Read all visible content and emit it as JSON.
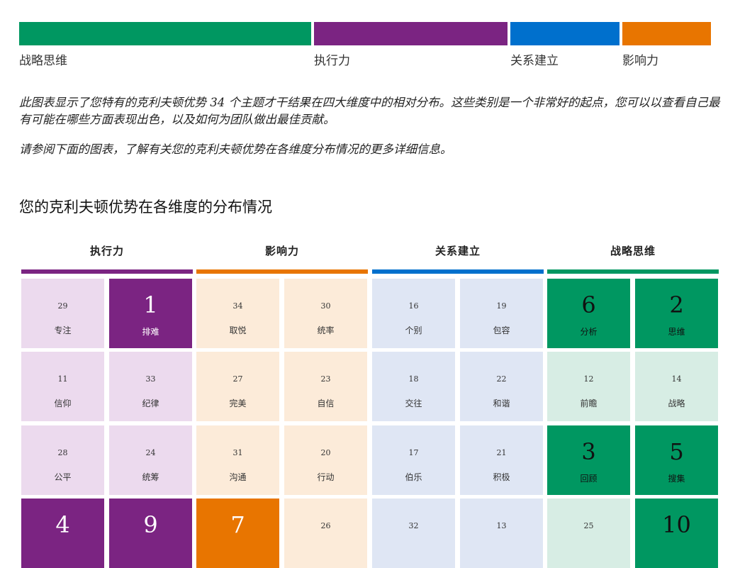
{
  "colors": {
    "execution": "#7b2482",
    "execution_light": "#ecdaee",
    "influence": "#e87500",
    "influence_light": "#fcebd9",
    "relationship": "#0070cd",
    "relationship_light": "#dfe6f4",
    "strategic": "#009761",
    "strategic_light": "#d7ede4"
  },
  "top_bars": [
    {
      "label": "战略思维",
      "key": "strategic"
    },
    {
      "label": "执行力",
      "key": "execution"
    },
    {
      "label": "关系建立",
      "key": "relationship"
    },
    {
      "label": "影响力",
      "key": "influence"
    }
  ],
  "intro": {
    "paragraph1": "此图表显示了您特有的克利夫顿优势 34 个主题才干结果在四大维度中的相对分布。这些类别是一个非常好的起点，您可以以查看自己最有可能在哪些方面表现出色，以及如何为团队做出最佳贡献。",
    "paragraph2": "请参阅下面的图表，了解有关您的克利夫顿优势在各维度分布情况的更多详细信息。"
  },
  "section_title": "您的克利夫顿优势在各维度的分布情况",
  "domains": [
    {
      "name": "执行力",
      "key": "execution",
      "themes": [
        {
          "rank": "29",
          "name": "专注",
          "strong": false
        },
        {
          "rank": "1",
          "name": "排难",
          "strong": true
        },
        {
          "rank": "11",
          "name": "信仰",
          "strong": false
        },
        {
          "rank": "33",
          "name": "纪律",
          "strong": false
        },
        {
          "rank": "28",
          "name": "公平",
          "strong": false
        },
        {
          "rank": "24",
          "name": "统筹",
          "strong": false
        },
        {
          "rank": "4",
          "name": "",
          "strong": true
        },
        {
          "rank": "9",
          "name": "",
          "strong": true
        }
      ]
    },
    {
      "name": "影响力",
      "key": "influence",
      "themes": [
        {
          "rank": "34",
          "name": "取悦",
          "strong": false
        },
        {
          "rank": "30",
          "name": "统率",
          "strong": false
        },
        {
          "rank": "27",
          "name": "完美",
          "strong": false
        },
        {
          "rank": "23",
          "name": "自信",
          "strong": false
        },
        {
          "rank": "31",
          "name": "沟通",
          "strong": false
        },
        {
          "rank": "20",
          "name": "行动",
          "strong": false
        },
        {
          "rank": "7",
          "name": "",
          "strong": true
        },
        {
          "rank": "26",
          "name": "",
          "strong": false
        }
      ]
    },
    {
      "name": "关系建立",
      "key": "relationship",
      "themes": [
        {
          "rank": "16",
          "name": "个别",
          "strong": false
        },
        {
          "rank": "19",
          "name": "包容",
          "strong": false
        },
        {
          "rank": "18",
          "name": "交往",
          "strong": false
        },
        {
          "rank": "22",
          "name": "和谐",
          "strong": false
        },
        {
          "rank": "17",
          "name": "伯乐",
          "strong": false
        },
        {
          "rank": "21",
          "name": "积极",
          "strong": false
        },
        {
          "rank": "32",
          "name": "",
          "strong": false
        },
        {
          "rank": "13",
          "name": "",
          "strong": false
        }
      ]
    },
    {
      "name": "战略思维",
      "key": "strategic",
      "themes": [
        {
          "rank": "6",
          "name": "分析",
          "strong": true
        },
        {
          "rank": "2",
          "name": "思维",
          "strong": true
        },
        {
          "rank": "12",
          "name": "前瞻",
          "strong": false
        },
        {
          "rank": "14",
          "name": "战略",
          "strong": false
        },
        {
          "rank": "3",
          "name": "回顾",
          "strong": true
        },
        {
          "rank": "5",
          "name": "搜集",
          "strong": true
        },
        {
          "rank": "25",
          "name": "",
          "strong": false
        },
        {
          "rank": "10",
          "name": "",
          "strong": true
        }
      ]
    }
  ]
}
